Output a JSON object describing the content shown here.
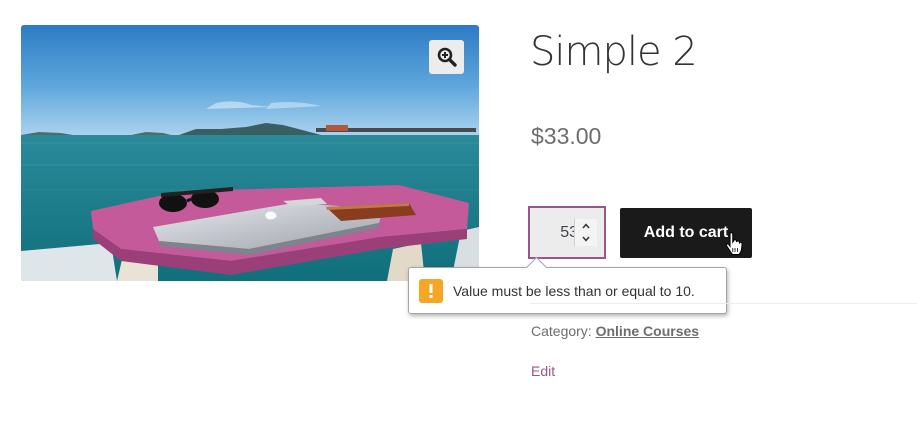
{
  "product": {
    "title": "Simple 2",
    "price": "$33.00",
    "quantity_value": "53",
    "add_to_cart_label": "Add to cart",
    "category_label": "Category:",
    "category_link": "Online Courses",
    "edit_label": "Edit"
  },
  "gallery": {
    "zoom_icon": "magnify-plus-icon"
  },
  "validation": {
    "message": "Value must be less than or equal to 10.",
    "icon": "warning-icon",
    "icon_glyph": "!"
  },
  "colors": {
    "accent": "#96588a",
    "button_bg": "#1a1a1a",
    "warning": "#f5a623"
  }
}
